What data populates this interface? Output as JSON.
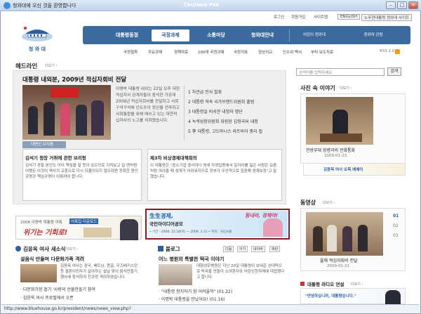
{
  "window": {
    "title": "청와대에 오신 것을 환영합니다",
    "center_label": "Chulwoo Pak",
    "min": "–",
    "max": "□",
    "close": "✕"
  },
  "util": {
    "login": "로그인",
    "join": "회원가입",
    "sitemap": "사이트맵",
    "english": "ENGLISH",
    "old_site": "노무현대통령 청와대 사이트"
  },
  "logo": {
    "text": "청 와 대"
  },
  "nav": {
    "items": [
      "대통령동정",
      "국정과제",
      "소통마당",
      "청와대안내"
    ],
    "right": [
      "어린이 청와대",
      "청와대 관람"
    ]
  },
  "subnav": [
    "국정철학",
    "주요과제",
    "정책자료",
    "100대 국정과제",
    "국정지표",
    "정상외교",
    "인수위 백서",
    "부처 보도자료"
  ],
  "rss": "RSS 2.0",
  "headline": {
    "title": "헤드라인",
    "more": "더보기 ›",
    "main_title": "대통령 내외분, 2009년 적십자회비 전달",
    "main_text": "이명박 대통령 내외는 22일 오후 대한적십자사 관계자들이 참석한 가운데 2009년 적십자회비를 전달하고 사회 구석구석에 인도주의 정신을 전파하고 사회통합을 위해 애쓰고 있는 대한적십자사의 노고를 치하했습니다.",
    "list": [
      "1 차관급 인사 발표",
      "2 대통령 직속 국가브랜드위원회 출범",
      "3 대통령실 비서관 내정자 명단",
      "4 녹색성장위원회 위원장 김형국씨 내정",
      "5 李 대통령, 고드머니스 라트비아 총리 접"
    ],
    "briefing_label": "대변인 브리핑"
  },
  "briefs": {
    "left_title": "김석기 청장 거취에 관한 브리핑",
    "left_text": "김석기 경찰 본인도 이미 책임을 질 뜻이 있으므로 지켜보고 일 맨처럼 어쨌든 이것이 역사의 교훈으로 다시 되풀이되지 않으려면 정확한 원인규명과 책임규명이 이뤄져야 합니다.",
    "right_title": "제3차 비상경제대책회의",
    "right_text": "이 대통령은 \"중소기업 중사자나 영세 자영업종에서 일자리를 잃은 사람은 요즘처럼 여려울 때 생계가 어려워지므로 정부가 우선적으로 집중해 생계보장\"고 말했습니다."
  },
  "banner": {
    "year_text": "2008 이명박 대통령 어록",
    "tag": "어록집 다운로드",
    "slogan": "위기는 기회로!"
  },
  "ad": {
    "title": "生生경제,",
    "subtitle": "국민아이디어공모",
    "period": "• 기간 : 2008. 12.18(목) ~ 2009. 1.31 • 주최 : 국민소통",
    "script": "힘내라, 경제야!"
  },
  "side": {
    "search_placeholder": "검색어를 입력하세요",
    "search_btn": "검색",
    "photo_title": "사진 속 이야기",
    "photo_more": "더보기 ›",
    "photo_caption": "전방부대 장병과의 전화통화",
    "photo_date": "2009-01-23",
    "mini_banner": "김윤옥 여사 오목 예예이",
    "video_title": "동영상",
    "video_more": "더보기 ›",
    "video_pages": [
      "01",
      "02",
      "03"
    ],
    "video_caption": "올해 적십자회비 전달",
    "video_date": "2009-01-21",
    "radio_title": "대통령 라디오 연설",
    "radio_more": "더보기 ›",
    "radio_text": "\"안녕하십니까, 대통령입니다.\""
  },
  "column": {
    "title": "김윤옥 여사 새소식",
    "more": "더보기 ›",
    "head": "설음식 만들며 다문화가족 격려",
    "text": "김윤옥 여사는 중국, 베트남, 몽골, 우즈베키스탄 등 결혼이민자가 살아하는 설날 맞이 음식만들기 행사에 참석하여 전과정 격려하였습니다.",
    "list": [
      "다문화가정 돕기 '사랑의 선물만들기 참여",
      "김윤옥 여사 프로필에서 오픈"
    ]
  },
  "blog": {
    "title": "블로그",
    "tabs": [
      "다음",
      "이거",
      "네이버",
      "파란"
    ],
    "head": "어느 병원의 특별한 떡국 이야기",
    "text": "대형성모병원은 지난 20일 대통령이 보내준 선대떡으로 떡국을 만들어 소아환자와 어린신한자매에 대접했다고 합니다.",
    "list": [
      "\"대통령 청치하기 참 어려울까\" (01.22)",
      "이명박 대통령을 만났어요! (01.16)"
    ]
  },
  "status": {
    "url": "http://www.bluehouse.go.kr/president/news/news_view.php?"
  }
}
